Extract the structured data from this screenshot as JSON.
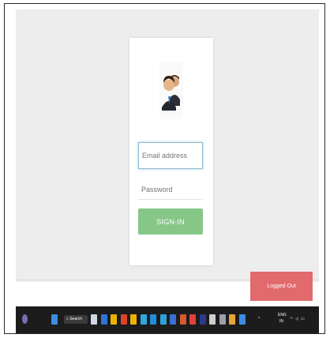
{
  "login": {
    "email_placeholder": "Email address",
    "password_placeholder": "Password",
    "signin_label": "SIGN-IN"
  },
  "footer": {
    "logout_label": "Logged Out"
  },
  "taskbar": {
    "search_label": "Search",
    "language": "ENG",
    "region": "IN",
    "pinned_icons": [
      "file-explorer-icon",
      "chrome-icon",
      "office-icon",
      "folder-icon",
      "store-icon",
      "edge-icon",
      "vscode-icon",
      "notepad-icon",
      "photos-icon",
      "powerpoint-icon",
      "record-icon",
      "terminal-icon",
      "notion-icon",
      "calculator-icon",
      "paint-icon",
      "app-icon"
    ],
    "icon_colors": [
      "#cfd6e4",
      "#2f74d6",
      "#e8b400",
      "#d9442f",
      "#f0b000",
      "#2fa8e0",
      "#1e8ed8",
      "#2da1d8",
      "#3a6fd1",
      "#d55a2c",
      "#e0413b",
      "#2b3a8a",
      "#cfcfcf",
      "#9aa0a8",
      "#e5a534",
      "#3b8de0"
    ]
  }
}
